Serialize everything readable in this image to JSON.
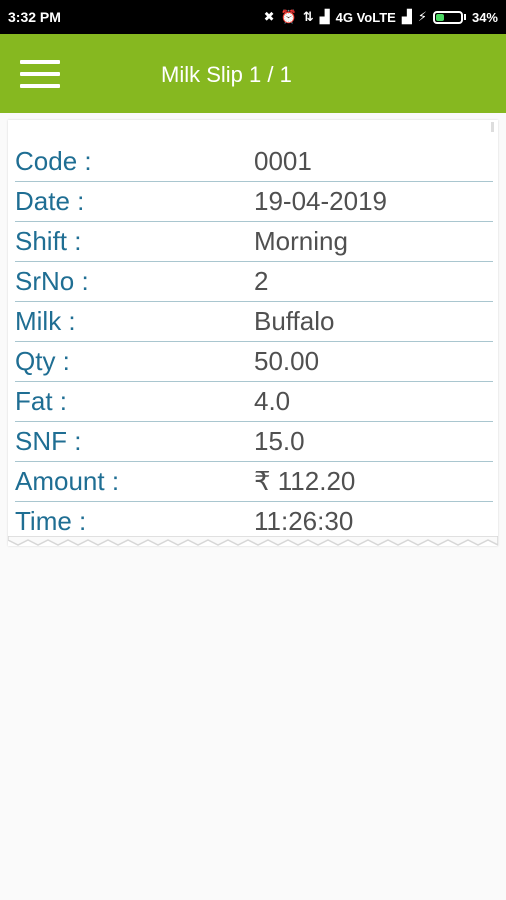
{
  "status_bar": {
    "time": "3:32 PM",
    "icons": [
      "mute-icon",
      "alarm-icon",
      "network-icon",
      "signal-icon",
      "signal-icon",
      "charging-icon"
    ],
    "network_label": "4G VoLTE",
    "battery_percent": "34%",
    "battery_level": 0.34,
    "battery_color": "#4cd964"
  },
  "app_bar": {
    "title": "Milk Slip 1 / 1",
    "background": "#86b820",
    "menu_icon": "hamburger-menu-icon"
  },
  "slip": {
    "label_color": "#1f6e93",
    "value_color": "#505050",
    "rows": [
      {
        "label": "Code :",
        "value": "0001"
      },
      {
        "label": "Date :",
        "value": "19-04-2019"
      },
      {
        "label": "Shift :",
        "value": "Morning"
      },
      {
        "label": "SrNo :",
        "value": "2"
      },
      {
        "label": "Milk :",
        "value": "Buffalo"
      },
      {
        "label": "Qty :",
        "value": "50.00"
      },
      {
        "label": "Fat :",
        "value": "4.0"
      },
      {
        "label": "SNF :",
        "value": "15.0"
      },
      {
        "label": "Amount :",
        "value": "₹ 112.20"
      },
      {
        "label": "Time :",
        "value": "11:26:30"
      }
    ]
  }
}
